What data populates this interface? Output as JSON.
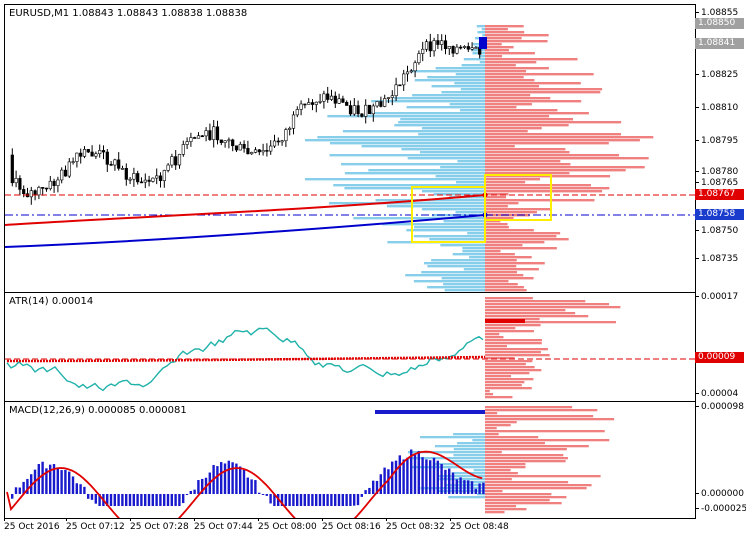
{
  "main_label": "EURUSD,M1  1.08843 1.08843 1.08838 1.08838",
  "atr_label": "ATR(14) 0.00014",
  "macd_label": "MACD(12,26,9) 0.000085 0.000081",
  "main_scale": [
    "1.08855",
    "1.08825",
    "1.08810",
    "1.08795",
    "1.08780",
    "1.08765",
    "1.08750",
    "1.08735"
  ],
  "main_tags": {
    "bid": "1.08850",
    "ask": "1.08841",
    "red_line": "1.08767",
    "blue_line": "1.08758"
  },
  "atr_scale": [
    "0.00017",
    "0.00004"
  ],
  "atr_tag": "0.00009",
  "macd_scale": [
    "0.000098",
    "0.000000",
    "-0.000025"
  ],
  "time_labels": [
    "25 Oct 2016",
    "25 Oct 07:12",
    "25 Oct 07:28",
    "25 Oct 07:44",
    "25 Oct 08:00",
    "25 Oct 08:16",
    "25 Oct 08:32",
    "25 Oct 08:48"
  ],
  "colors": {
    "bull_candle": "#ffffff",
    "bear_candle": "#000000",
    "volume_profile_left": "#87ceeb",
    "volume_profile_right": "#f08080",
    "red_ma": "#e00000",
    "blue_ma": "#0000cc",
    "highlight_box": "#ffee00",
    "atr_line": "#20b2aa",
    "macd_histogram": "#1a1acd",
    "macd_signal": "#e00000"
  },
  "chart_data": [
    {
      "type": "candlestick",
      "title": "EURUSD,M1",
      "ylim": [
        1.0873,
        1.0886
      ],
      "ticks": [
        1.08855,
        1.08825,
        1.0881,
        1.08795,
        1.0878,
        1.08765,
        1.0875,
        1.08735
      ],
      "red_ma_last": 1.08767,
      "blue_ma_last": 1.08758
    },
    {
      "type": "line",
      "title": "ATR(14)",
      "last_value": 0.00014,
      "ylim": [
        3e-05,
        0.00018
      ],
      "dashed_level": 9e-05
    },
    {
      "type": "bar",
      "title": "MACD(12,26,9)",
      "main": 8.5e-05,
      "signal": 8.1e-05,
      "ylim": [
        -3e-05,
        0.0001
      ]
    }
  ]
}
